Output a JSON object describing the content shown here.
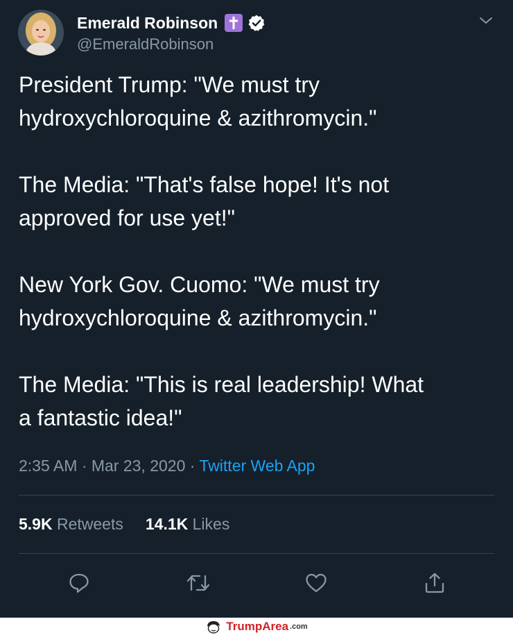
{
  "author": {
    "display_name": "Emerald Robinson",
    "handle": "@EmeraldRobinson",
    "badge_emoji": "latin-cross-icon",
    "verified": true
  },
  "tweet": {
    "paragraphs": [
      [
        "President Trump: \"We must try",
        "hydroxychloroquine & azithromycin.\""
      ],
      [
        "The Media: \"That's false hope! It's not",
        "approved for use yet!\""
      ],
      [
        "New York Gov. Cuomo: \"We must try",
        "hydroxychloroquine & azithromycin.\""
      ],
      [
        "The Media: \"This is real leadership! What",
        "a fantastic idea!\""
      ]
    ],
    "time": "2:35 AM",
    "date": "Mar 23, 2020",
    "separator": "·",
    "source": "Twitter Web App"
  },
  "stats": {
    "retweets_count": "5.9K",
    "retweets_label": "Retweets",
    "likes_count": "14.1K",
    "likes_label": "Likes"
  },
  "actions": [
    "reply-icon",
    "retweet-icon",
    "like-icon",
    "share-icon"
  ],
  "footer": {
    "brand": "TrumpArea",
    "domain": ".com"
  },
  "colors": {
    "background": "#15202b",
    "text": "#ffffff",
    "secondary_text": "#8899a6",
    "link": "#1da1f2",
    "divider": "#38444d",
    "footer_brand": "#d32027"
  }
}
